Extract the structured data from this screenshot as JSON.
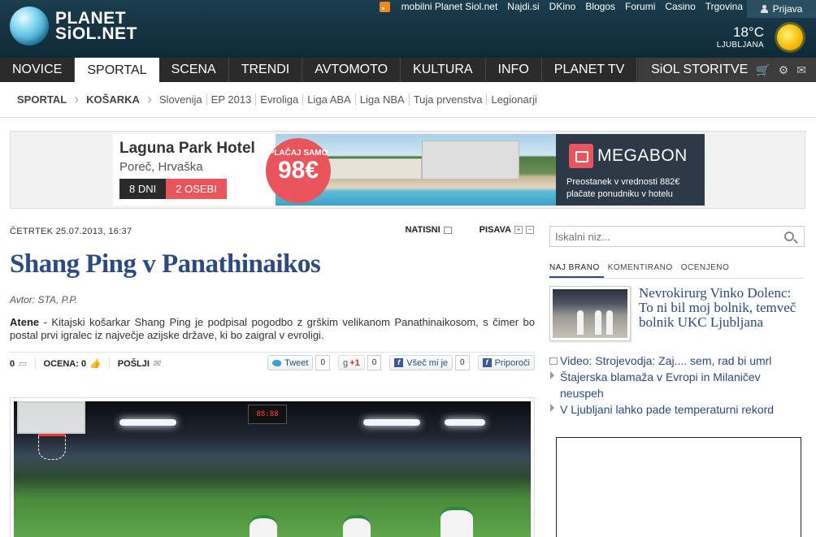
{
  "header": {
    "logo_line1": "PLANET",
    "logo_line2": "SiOL.NET",
    "top_links": [
      "mobilni Planet Siol.net",
      "Najdi.si",
      "DKino",
      "Blogos",
      "Forumi",
      "Casino",
      "Trgovina"
    ],
    "login_label": "Prijava",
    "weather": {
      "temperature": "18°C",
      "city": "LJUBLJANA"
    }
  },
  "nav": {
    "items": [
      "NOVICE",
      "SPORTAL",
      "SCENA",
      "TRENDI",
      "AVTOMOTO",
      "KULTURA",
      "INFO",
      "PLANET TV"
    ],
    "active": "SPORTAL",
    "services_label": "SiOL STORITVE"
  },
  "subnav": {
    "crumbs": [
      "SPORTAL",
      "KOŠARKA"
    ],
    "links": [
      "Slovenija",
      "EP 2013",
      "Evroliga",
      "Liga ABA",
      "Liga NBA",
      "Tuja prvenstva",
      "Legionarji"
    ]
  },
  "banner": {
    "hotel_name": "Laguna Park Hotel",
    "location": "Poreč, Hrvaška",
    "tag_days": "8 DNI",
    "tag_people": "2 OSEBI",
    "price_prefix": "PLAČAJ SAMO",
    "price": "98€",
    "brand": "MEGABON",
    "copy_line1": "Preostanek v vrednosti 882€",
    "copy_line2": "plačate ponudniku v hotelu"
  },
  "article": {
    "date": "ČETRTEK 25.07.2013, 16:37",
    "print_label": "NATISNI",
    "font_label": "PISAVA",
    "title": "Shang Ping v Panathinaikos",
    "author": "Avtor: STA, P.P.",
    "lead_place": "Atene",
    "lead_text": " - Kitajski košarkar Shang Ping je podpisal pogodbo z grškim velikanom Panathinaikosom, s čimer bo postal prvi igralec iz največje azijske države, ki bo zaigral v evroligi.",
    "comments_count": "0",
    "rating_label": "OCENA: 0",
    "send_label": "POŠLJI",
    "tweet_label": "Tweet",
    "tweet_count": "0",
    "gplus_label": "+1",
    "gplus_count": "0",
    "fb_like_label": "Všeč mi je",
    "fb_like_count": "0",
    "fb_share_label": "Priporoči",
    "scoreboard": "88:88"
  },
  "sidebar": {
    "search_placeholder": "Iskalni niz...",
    "tabs": [
      "NAJ BRANO",
      "KOMENTIRANO",
      "OCENJENO"
    ],
    "feature_title": "Nevrokirurg Vinko Dolenc: To ni bil moj bolnik, temveč bolnik UKC Ljubljana",
    "news": [
      "Video: Strojevodja: Zaj.... sem, rad bi umrl",
      "Štajerska blamaža v Evropi in Milaničev neuspeh",
      "V Ljubljani lahko pade temperaturni rekord"
    ]
  },
  "colors": {
    "header_bg": "#15333f",
    "nav_bg": "#2b2b2b",
    "title_blue": "#2d4a80",
    "banner_red": "#e9555c"
  }
}
